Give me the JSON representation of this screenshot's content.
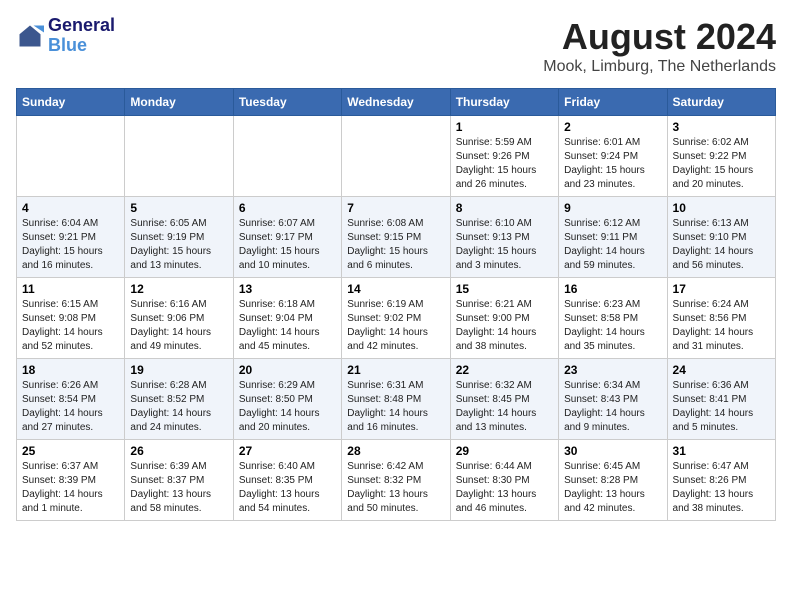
{
  "header": {
    "logo_line1": "General",
    "logo_line2": "Blue",
    "title": "August 2024",
    "subtitle": "Mook, Limburg, The Netherlands"
  },
  "days_of_week": [
    "Sunday",
    "Monday",
    "Tuesday",
    "Wednesday",
    "Thursday",
    "Friday",
    "Saturday"
  ],
  "weeks": [
    [
      {
        "day": "",
        "info": ""
      },
      {
        "day": "",
        "info": ""
      },
      {
        "day": "",
        "info": ""
      },
      {
        "day": "",
        "info": ""
      },
      {
        "day": "1",
        "info": "Sunrise: 5:59 AM\nSunset: 9:26 PM\nDaylight: 15 hours\nand 26 minutes."
      },
      {
        "day": "2",
        "info": "Sunrise: 6:01 AM\nSunset: 9:24 PM\nDaylight: 15 hours\nand 23 minutes."
      },
      {
        "day": "3",
        "info": "Sunrise: 6:02 AM\nSunset: 9:22 PM\nDaylight: 15 hours\nand 20 minutes."
      }
    ],
    [
      {
        "day": "4",
        "info": "Sunrise: 6:04 AM\nSunset: 9:21 PM\nDaylight: 15 hours\nand 16 minutes."
      },
      {
        "day": "5",
        "info": "Sunrise: 6:05 AM\nSunset: 9:19 PM\nDaylight: 15 hours\nand 13 minutes."
      },
      {
        "day": "6",
        "info": "Sunrise: 6:07 AM\nSunset: 9:17 PM\nDaylight: 15 hours\nand 10 minutes."
      },
      {
        "day": "7",
        "info": "Sunrise: 6:08 AM\nSunset: 9:15 PM\nDaylight: 15 hours\nand 6 minutes."
      },
      {
        "day": "8",
        "info": "Sunrise: 6:10 AM\nSunset: 9:13 PM\nDaylight: 15 hours\nand 3 minutes."
      },
      {
        "day": "9",
        "info": "Sunrise: 6:12 AM\nSunset: 9:11 PM\nDaylight: 14 hours\nand 59 minutes."
      },
      {
        "day": "10",
        "info": "Sunrise: 6:13 AM\nSunset: 9:10 PM\nDaylight: 14 hours\nand 56 minutes."
      }
    ],
    [
      {
        "day": "11",
        "info": "Sunrise: 6:15 AM\nSunset: 9:08 PM\nDaylight: 14 hours\nand 52 minutes."
      },
      {
        "day": "12",
        "info": "Sunrise: 6:16 AM\nSunset: 9:06 PM\nDaylight: 14 hours\nand 49 minutes."
      },
      {
        "day": "13",
        "info": "Sunrise: 6:18 AM\nSunset: 9:04 PM\nDaylight: 14 hours\nand 45 minutes."
      },
      {
        "day": "14",
        "info": "Sunrise: 6:19 AM\nSunset: 9:02 PM\nDaylight: 14 hours\nand 42 minutes."
      },
      {
        "day": "15",
        "info": "Sunrise: 6:21 AM\nSunset: 9:00 PM\nDaylight: 14 hours\nand 38 minutes."
      },
      {
        "day": "16",
        "info": "Sunrise: 6:23 AM\nSunset: 8:58 PM\nDaylight: 14 hours\nand 35 minutes."
      },
      {
        "day": "17",
        "info": "Sunrise: 6:24 AM\nSunset: 8:56 PM\nDaylight: 14 hours\nand 31 minutes."
      }
    ],
    [
      {
        "day": "18",
        "info": "Sunrise: 6:26 AM\nSunset: 8:54 PM\nDaylight: 14 hours\nand 27 minutes."
      },
      {
        "day": "19",
        "info": "Sunrise: 6:28 AM\nSunset: 8:52 PM\nDaylight: 14 hours\nand 24 minutes."
      },
      {
        "day": "20",
        "info": "Sunrise: 6:29 AM\nSunset: 8:50 PM\nDaylight: 14 hours\nand 20 minutes."
      },
      {
        "day": "21",
        "info": "Sunrise: 6:31 AM\nSunset: 8:48 PM\nDaylight: 14 hours\nand 16 minutes."
      },
      {
        "day": "22",
        "info": "Sunrise: 6:32 AM\nSunset: 8:45 PM\nDaylight: 14 hours\nand 13 minutes."
      },
      {
        "day": "23",
        "info": "Sunrise: 6:34 AM\nSunset: 8:43 PM\nDaylight: 14 hours\nand 9 minutes."
      },
      {
        "day": "24",
        "info": "Sunrise: 6:36 AM\nSunset: 8:41 PM\nDaylight: 14 hours\nand 5 minutes."
      }
    ],
    [
      {
        "day": "25",
        "info": "Sunrise: 6:37 AM\nSunset: 8:39 PM\nDaylight: 14 hours\nand 1 minute."
      },
      {
        "day": "26",
        "info": "Sunrise: 6:39 AM\nSunset: 8:37 PM\nDaylight: 13 hours\nand 58 minutes."
      },
      {
        "day": "27",
        "info": "Sunrise: 6:40 AM\nSunset: 8:35 PM\nDaylight: 13 hours\nand 54 minutes."
      },
      {
        "day": "28",
        "info": "Sunrise: 6:42 AM\nSunset: 8:32 PM\nDaylight: 13 hours\nand 50 minutes."
      },
      {
        "day": "29",
        "info": "Sunrise: 6:44 AM\nSunset: 8:30 PM\nDaylight: 13 hours\nand 46 minutes."
      },
      {
        "day": "30",
        "info": "Sunrise: 6:45 AM\nSunset: 8:28 PM\nDaylight: 13 hours\nand 42 minutes."
      },
      {
        "day": "31",
        "info": "Sunrise: 6:47 AM\nSunset: 8:26 PM\nDaylight: 13 hours\nand 38 minutes."
      }
    ]
  ]
}
